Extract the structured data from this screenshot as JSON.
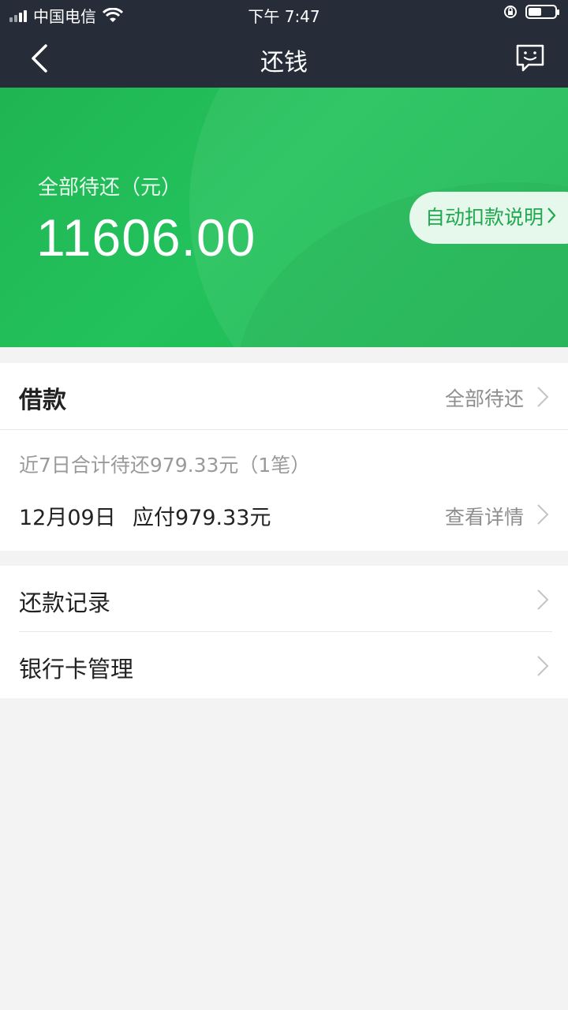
{
  "status_bar": {
    "carrier": "中国电信",
    "time": "下午 7:47",
    "battery_level": 0.5
  },
  "nav": {
    "title": "还钱",
    "back_icon": "chevron-left-icon",
    "message_icon": "chat-smile-icon"
  },
  "banner": {
    "label": "全部待还（元）",
    "amount": "11606.00",
    "auto_debit_label": "自动扣款说明",
    "accent": "#21bd58"
  },
  "loan": {
    "title": "借款",
    "all_pending_link": "全部待还",
    "week_summary": "近7日合计待还979.33元（1笔）",
    "due_date": "12月09日",
    "due_amount": "应付979.33元",
    "details_link": "查看详情"
  },
  "menu": {
    "items": [
      {
        "label": "还款记录"
      },
      {
        "label": "银行卡管理"
      }
    ]
  }
}
